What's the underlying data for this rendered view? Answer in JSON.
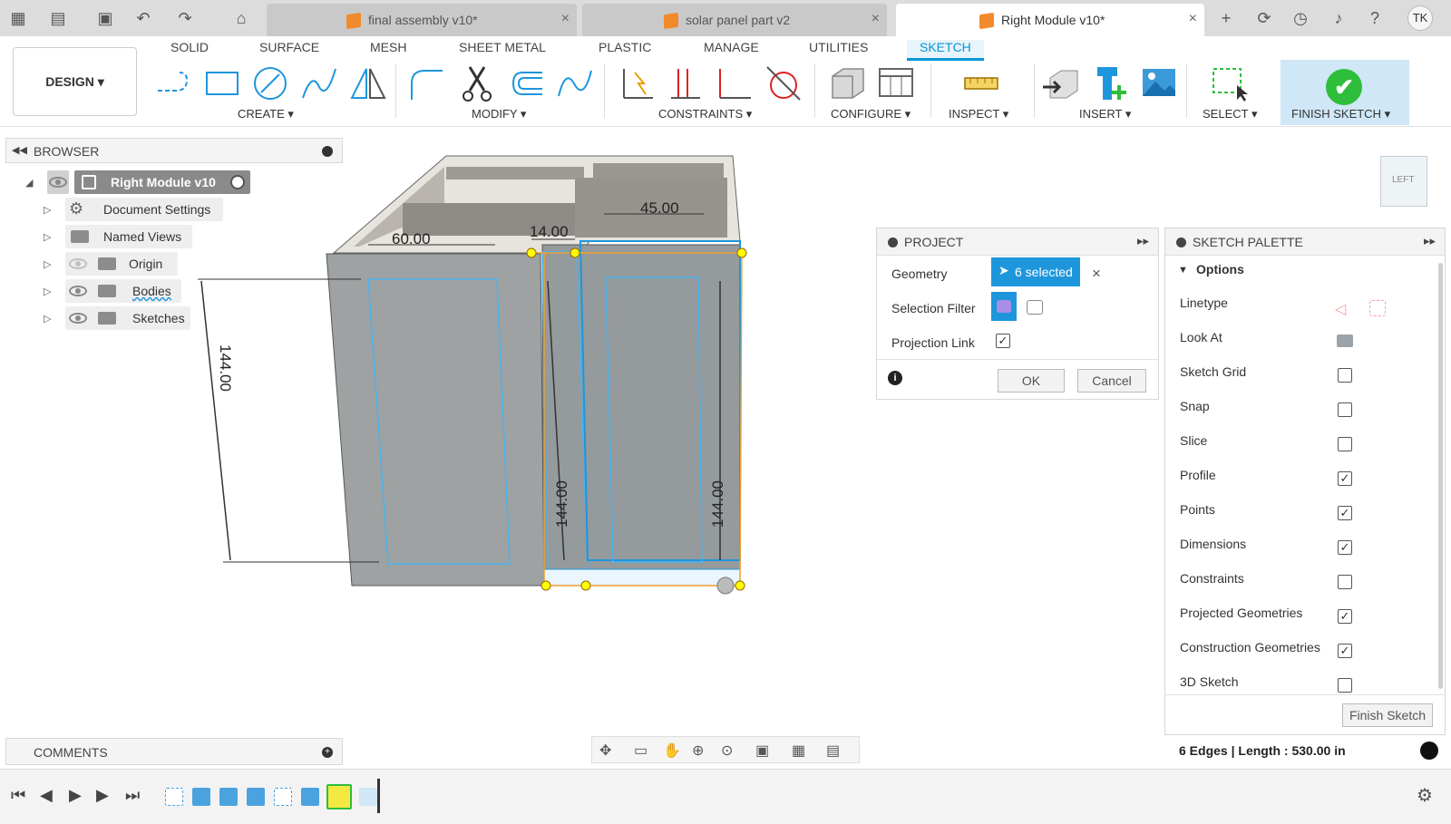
{
  "titlebar": {
    "tabs": [
      {
        "label": "final assembly v10*",
        "active": false
      },
      {
        "label": "solar panel part v2",
        "active": false
      },
      {
        "label": "Right Module v10*",
        "active": true
      }
    ],
    "avatar": "TK",
    "close_glyph": "×",
    "icons": [
      "grid-icon",
      "file-icon",
      "save-icon",
      "undo-icon",
      "redo-icon",
      "home-icon",
      "plus-icon",
      "extensions-icon",
      "clock-icon",
      "bell-icon",
      "help-icon"
    ]
  },
  "ribbon": {
    "workspace": "DESIGN ▾",
    "tabs": [
      "SOLID",
      "SURFACE",
      "MESH",
      "SHEET METAL",
      "PLASTIC",
      "MANAGE",
      "UTILITIES",
      "SKETCH"
    ],
    "active_tab": "SKETCH",
    "groups": [
      "CREATE ▾",
      "MODIFY ▾",
      "CONSTRAINTS ▾",
      "CONFIGURE ▾",
      "INSPECT ▾",
      "INSERT ▾",
      "SELECT ▾",
      "FINISH SKETCH ▾"
    ],
    "finish_check": "✔"
  },
  "browser": {
    "header": "BROWSER",
    "collapse_glyph": "◀◀",
    "items": [
      {
        "label": "Right Module v10"
      },
      {
        "label": "Document Settings"
      },
      {
        "label": "Named Views"
      },
      {
        "label": "Origin"
      },
      {
        "label": "Bodies"
      },
      {
        "label": "Sketches"
      }
    ]
  },
  "dimensions": {
    "d1": "60.00",
    "d2": "14.00",
    "d3": "45.00",
    "d4": "144.00",
    "d5": "144.00",
    "d6": "144.00"
  },
  "viewcube": {
    "label": "LEFT"
  },
  "project": {
    "header": "PROJECT",
    "geometry_label": "Geometry",
    "geometry_value": "6 selected",
    "clear_glyph": "×",
    "filter_label": "Selection Filter",
    "projection_label": "Projection Link",
    "projection_checked": true,
    "ok": "OK",
    "cancel": "Cancel",
    "info_glyph": "i"
  },
  "palette": {
    "header": "SKETCH PALETTE",
    "section": "Options",
    "rows": [
      {
        "label": "Linetype",
        "type": "icon"
      },
      {
        "label": "Look At",
        "type": "icon"
      },
      {
        "label": "Sketch Grid",
        "checked": false
      },
      {
        "label": "Snap",
        "checked": false
      },
      {
        "label": "Slice",
        "checked": false
      },
      {
        "label": "Profile",
        "checked": true
      },
      {
        "label": "Points",
        "checked": true
      },
      {
        "label": "Dimensions",
        "checked": true
      },
      {
        "label": "Constraints",
        "checked": false
      },
      {
        "label": "Projected Geometries",
        "checked": true
      },
      {
        "label": "Construction Geometries",
        "checked": true
      },
      {
        "label": "3D Sketch",
        "checked": false
      }
    ],
    "finish_button": "Finish Sketch",
    "check_glyph": "✓"
  },
  "comments": {
    "label": "COMMENTS"
  },
  "status": {
    "text": "6 Edges | Length : 530.00 in"
  },
  "colors": {
    "accent": "#0696d7",
    "selection": "#1e96dc",
    "finish": "#2fbe3b",
    "sketch_line": "#4ab3f0"
  }
}
